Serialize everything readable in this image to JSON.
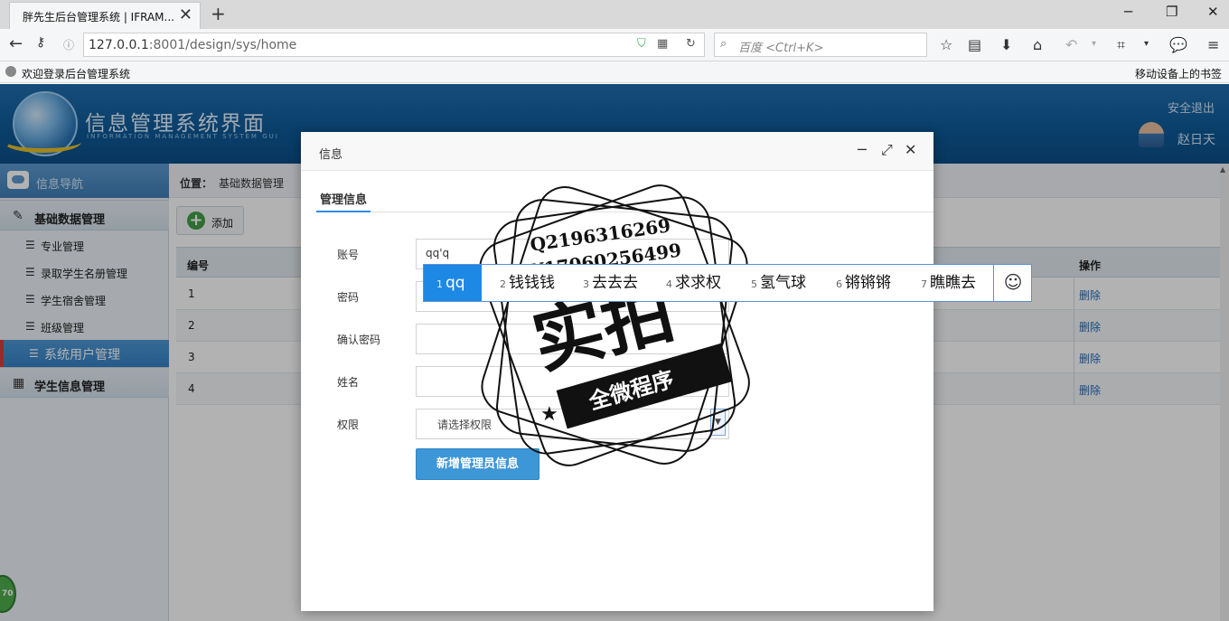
{
  "browser": {
    "tab_title": "胖先生后台管理系统 | IFRAM...",
    "url_host": "127.0.0.1",
    "url_rest": ":8001/design/sys/home",
    "search_placeholder": "百度 <Ctrl+K>",
    "bookmark_label": "欢迎登录后台管理系统",
    "bookmark_right": "移动设备上的书签"
  },
  "header": {
    "title": "信息管理系统界面",
    "subtitle": "INFORMATION MANAGEMENT SYSTEM GUI",
    "logout": "安全退出",
    "username": "赵日天"
  },
  "sidebar": {
    "head": "信息导航",
    "groups": [
      {
        "label": "基础数据管理",
        "items": [
          {
            "label": "专业管理"
          },
          {
            "label": "录取学生名册管理"
          },
          {
            "label": "学生宿舍管理"
          },
          {
            "label": "班级管理"
          },
          {
            "label": "系统用户管理",
            "active": true
          }
        ]
      },
      {
        "label": "学生信息管理"
      }
    ]
  },
  "main": {
    "breadcrumb_label": "位置：",
    "breadcrumb_item": "基础数据管理",
    "add_button": "添加",
    "table": {
      "col_id": "编号",
      "col_op": "操作",
      "rows": [
        {
          "id": "1",
          "op": "删除"
        },
        {
          "id": "2",
          "op": "删除"
        },
        {
          "id": "3",
          "op": "删除"
        },
        {
          "id": "4",
          "op": "删除"
        }
      ]
    }
  },
  "dialog": {
    "title": "信息",
    "tab": "管理信息",
    "account_label": "账号",
    "account_value": "qq'q",
    "password_label": "密码",
    "confirm_label": "确认密码",
    "name_label": "姓名",
    "role_label": "权限",
    "role_placeholder": "请选择权限",
    "submit": "新增管理员信息"
  },
  "ime": {
    "candidates": [
      {
        "num": "1",
        "text": "qq"
      },
      {
        "num": "2",
        "text": "钱钱钱"
      },
      {
        "num": "3",
        "text": "去去去"
      },
      {
        "num": "4",
        "text": "求求权"
      },
      {
        "num": "5",
        "text": "氢气球"
      },
      {
        "num": "6",
        "text": "锵锵锵"
      },
      {
        "num": "7",
        "text": "瞧瞧去"
      }
    ]
  },
  "watermark": {
    "line1": "Q2196316269",
    "line2": "V17060256499",
    "big": "实拍",
    "ribbon": "全微程序"
  },
  "badge": "70"
}
